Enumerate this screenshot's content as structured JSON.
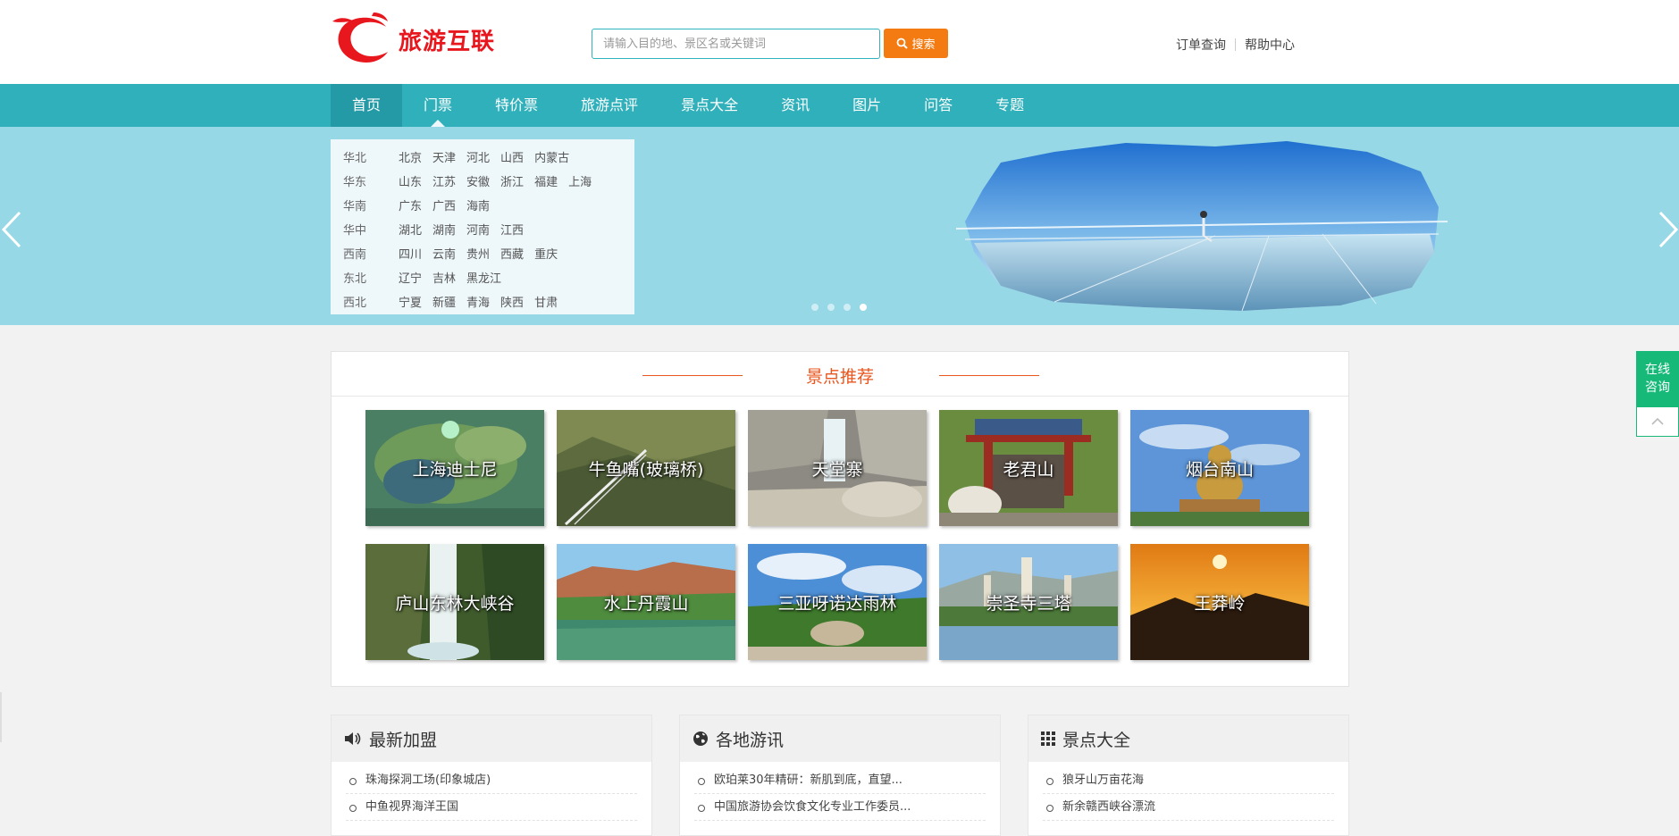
{
  "header": {
    "logo_text": "旅游互联",
    "search_placeholder": "请输入目的地、景区名或关键词",
    "search_button": "搜索",
    "links": [
      "订单查询",
      "帮助中心"
    ]
  },
  "nav": {
    "items": [
      "首页",
      "门票",
      "特价票",
      "旅游点评",
      "景点大全",
      "资讯",
      "图片",
      "问答",
      "专题"
    ],
    "active_index": 0
  },
  "dropdown": {
    "regions": [
      {
        "name": "华北",
        "provinces": [
          "北京",
          "天津",
          "河北",
          "山西",
          "内蒙古"
        ]
      },
      {
        "name": "华东",
        "provinces": [
          "山东",
          "江苏",
          "安徽",
          "浙江",
          "福建",
          "上海"
        ]
      },
      {
        "name": "华南",
        "provinces": [
          "广东",
          "广西",
          "海南"
        ]
      },
      {
        "name": "华中",
        "provinces": [
          "湖北",
          "湖南",
          "河南",
          "江西"
        ]
      },
      {
        "name": "西南",
        "provinces": [
          "四川",
          "云南",
          "贵州",
          "西藏",
          "重庆"
        ]
      },
      {
        "name": "东北",
        "provinces": [
          "辽宁",
          "吉林",
          "黑龙江"
        ]
      },
      {
        "name": "西北",
        "provinces": [
          "宁夏",
          "新疆",
          "青海",
          "陕西",
          "甘肃"
        ]
      }
    ]
  },
  "banner": {
    "slide_count": 4,
    "active_slide": 4
  },
  "recommend": {
    "title": "景点推荐",
    "spots": [
      "上海迪士尼",
      "牛鱼嘴(玻璃桥)",
      "天堂寨",
      "老君山",
      "烟台南山",
      "庐山东林大峡谷",
      "水上丹霞山",
      "三亚呀诺达雨林",
      "崇圣寺三塔",
      "王莽岭"
    ]
  },
  "panels": [
    {
      "title": "最新加盟",
      "icon": "speaker-icon",
      "items": [
        "珠海探洞工场(印象城店)",
        "中鱼视界海洋王国"
      ]
    },
    {
      "title": "各地游讯",
      "icon": "globe-icon",
      "items": [
        "欧珀莱30年精研：新肌到底，直望...",
        "中国旅游协会饮食文化专业工作委员..."
      ]
    },
    {
      "title": "景点大全",
      "icon": "grid-icon",
      "items": [
        "狼牙山万亩花海",
        "新余赣西峡谷漂流"
      ]
    }
  ],
  "side": {
    "consult_line1": "在线",
    "consult_line2": "咨询"
  },
  "colors": {
    "nav": "#30b0bb",
    "nav_active": "#249aa6",
    "search_button": "#f37b12",
    "logo_red": "#e8161d",
    "section_title": "#e8561e",
    "consult_green": "#17b979",
    "banner_bg": "#96d8e6"
  }
}
